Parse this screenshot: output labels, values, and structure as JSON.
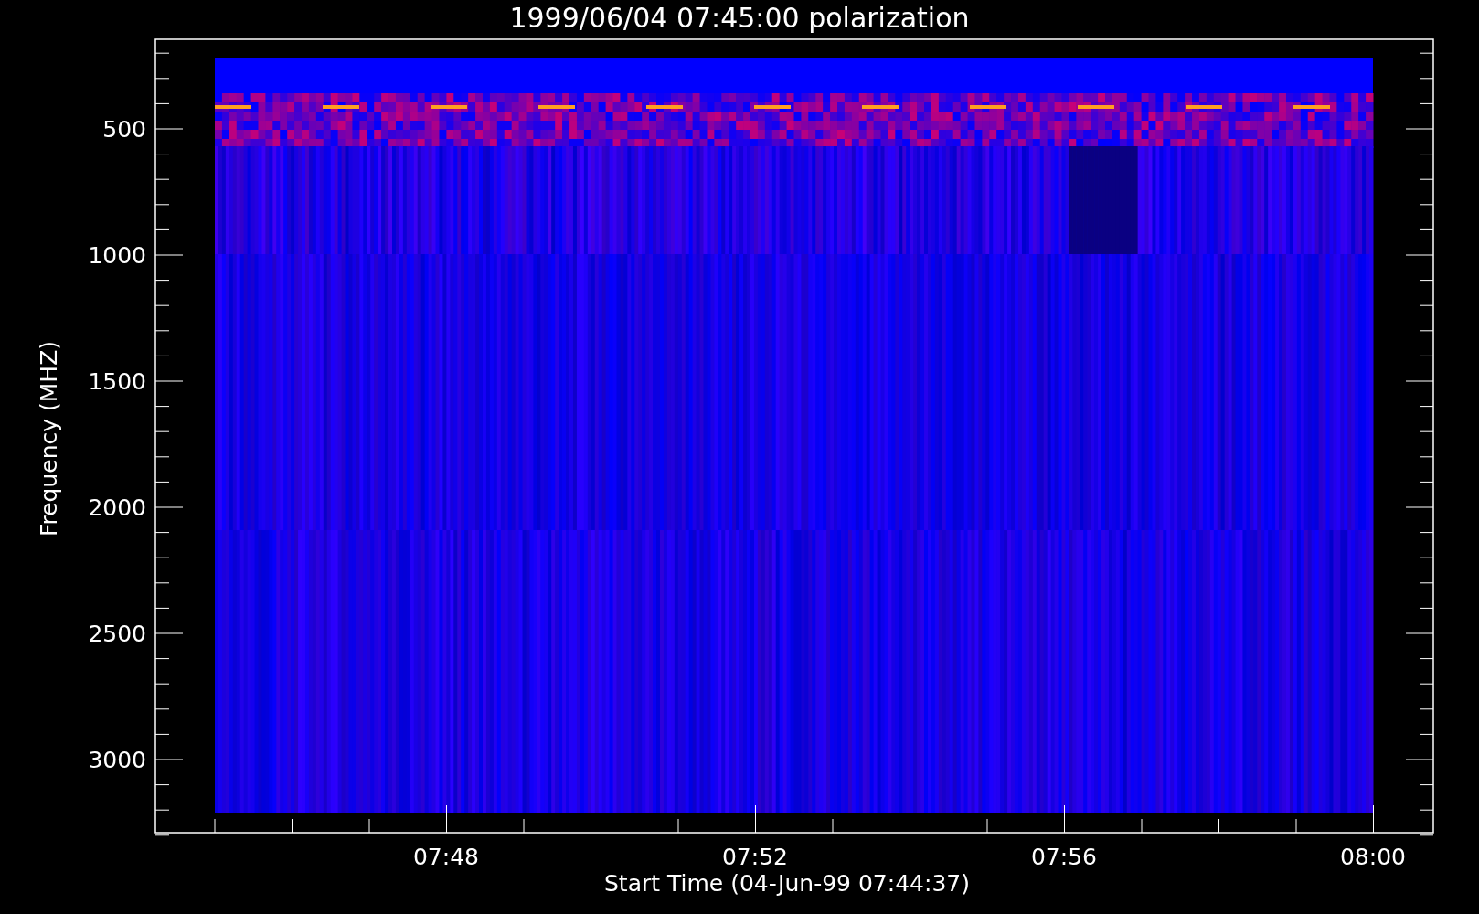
{
  "title": "1999/06/04 07:45:00 polarization",
  "y_axis": {
    "label": "Frequency (MHZ)",
    "ticks": [
      "500",
      "1000",
      "1500",
      "2000",
      "2500",
      "3000"
    ]
  },
  "x_axis": {
    "label": "Start Time (04-Jun-99 07:44:37)",
    "ticks": [
      "07:48",
      "07:52",
      "07:56",
      "08:00"
    ]
  }
}
